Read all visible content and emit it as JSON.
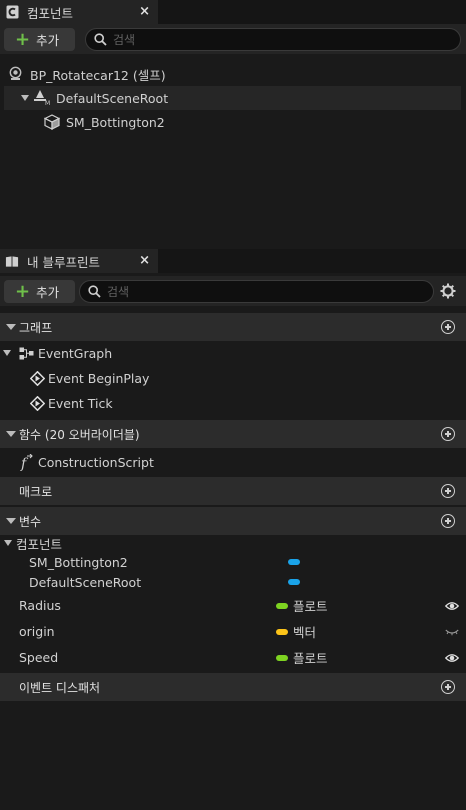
{
  "components_panel": {
    "tab_label": "컴포넌트",
    "close_glyph": "×",
    "add_label": "추가",
    "search_placeholder": "검색",
    "tree": [
      {
        "label": "BP_Rotatecar12 (셀프)",
        "icon": "actor-icon"
      },
      {
        "label": "DefaultSceneRoot",
        "icon": "scene-root-icon"
      },
      {
        "label": "SM_Bottington2",
        "icon": "static-mesh-icon"
      }
    ]
  },
  "blueprint_panel": {
    "tab_label": "내 블루프린트",
    "close_glyph": "×",
    "add_label": "추가",
    "search_placeholder": "검색",
    "sections": {
      "graphs": {
        "label": "그래프"
      },
      "functions": {
        "label": "함수 (20 오버라이더블)"
      },
      "macros": {
        "label": "매크로"
      },
      "variables": {
        "label": "변수"
      },
      "dispatchers": {
        "label": "이벤트 디스패처"
      }
    },
    "graphs": {
      "event_graph": "EventGraph",
      "events": [
        "Event BeginPlay",
        "Event Tick"
      ]
    },
    "functions": [
      "ConstructionScript"
    ],
    "variables": {
      "category": "컴포넌트",
      "components": [
        {
          "name": "SM_Bottington2",
          "color": "#1aa3e8"
        },
        {
          "name": "DefaultSceneRoot",
          "color": "#1aa3e8"
        }
      ],
      "items": [
        {
          "name": "Radius",
          "type": "플로트",
          "color": "#7ed321",
          "visibility": "eye-open-icon"
        },
        {
          "name": "origin",
          "type": "벡터",
          "color": "#fcc419",
          "visibility": "eye-closed-icon"
        },
        {
          "name": "Speed",
          "type": "플로트",
          "color": "#7ed321",
          "visibility": "eye-open-icon"
        }
      ]
    }
  },
  "colors": {
    "add_plus": "#6fc04a",
    "panel_bg": "#1a1a1a",
    "section_bg": "#2c2c2c"
  }
}
